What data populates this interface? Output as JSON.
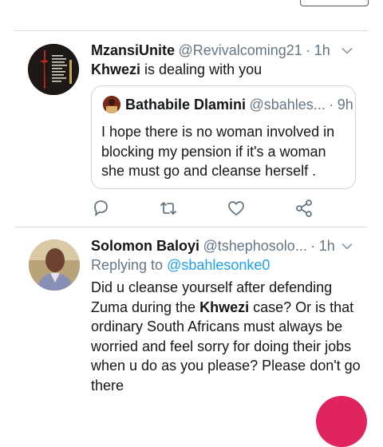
{
  "tweet1": {
    "display_name": "MzansiUnite",
    "handle": "@Revivalcoming21",
    "separator": "·",
    "time": "1h",
    "text_bold": "Khwezi",
    "text_rest": " is dealing with you"
  },
  "quoted": {
    "display_name": "Bathabile Dlamini",
    "handle": "@sbahles...",
    "separator": "·",
    "time": "9h",
    "line1": "I hope there is no woman involved in",
    "line2": "blocking my pension if it's a woman",
    "line3": "she must go and cleanse herself ."
  },
  "tweet2": {
    "display_name": "Solomon Baloyi",
    "handle": "@tshephosolo...",
    "separator": "·",
    "time": "1h",
    "replying_prefix": "Replying to",
    "replying_to": "@sbahlesonke0",
    "line1": "Did u cleanse yourself after defending",
    "line2_pre": "Zuma during the ",
    "line2_bold": "Khwezi",
    "line2_post": " case? Or is that",
    "line3": "ordinary South Africans must always be",
    "line4": "worried and feel sorry for doing their jobs",
    "line5": "when u do as you please? Please don't go",
    "line6": "there"
  },
  "actions": [
    "reply-icon",
    "retweet-icon",
    "like-icon",
    "share-icon"
  ],
  "colors": {
    "icon_gray": "#657786",
    "link_blue": "#1da1f2",
    "divider": "#d9dcdf",
    "fab": "#e0245e"
  }
}
